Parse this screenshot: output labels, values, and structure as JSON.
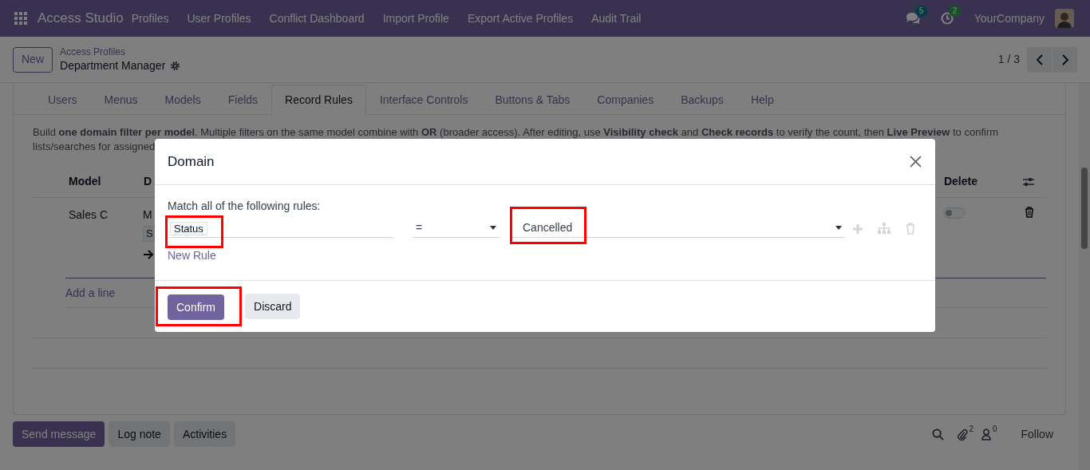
{
  "navbar": {
    "app_name": "Access Studio",
    "menu": [
      "Profiles",
      "User Profiles",
      "Conflict Dashboard",
      "Import Profile",
      "Export Active Profiles",
      "Audit Trail"
    ],
    "messages_count": "5",
    "activities_count": "2",
    "company": "YourCompany"
  },
  "control_panel": {
    "new_button": "New",
    "breadcrumb": "Access Profiles",
    "record_title": "Department Manager",
    "pager": "1 / 3"
  },
  "tabs": [
    {
      "label": "Users",
      "selected": false
    },
    {
      "label": "Menus",
      "selected": false
    },
    {
      "label": "Models",
      "selected": false
    },
    {
      "label": "Fields",
      "selected": false
    },
    {
      "label": "Record Rules",
      "selected": true
    },
    {
      "label": "Interface Controls",
      "selected": false
    },
    {
      "label": "Buttons & Tabs",
      "selected": false
    },
    {
      "label": "Companies",
      "selected": false
    },
    {
      "label": "Backups",
      "selected": false
    },
    {
      "label": "Help",
      "selected": false
    }
  ],
  "description": [
    "Build **one domain filter per model**. Multiple filters on the same model combine with **OR** (broader access). After editing, use **Visibility check** and **Check records** to verify the count, then **Live Preview** to confirm",
    "lists/searches for assigned"
  ],
  "table": {
    "columns": [
      "Model",
      "D",
      "Delete"
    ],
    "rows": [
      {
        "model": "Sales C",
        "domain": "M",
        "domain_tag": "S",
        "delete": false
      }
    ],
    "add_line": "Add a line"
  },
  "dialog": {
    "title": "Domain",
    "match_text": "Match all of the following rules:",
    "rules": [
      {
        "field": "Status",
        "field_highlighted": true,
        "operator": "=",
        "value": "Cancelled",
        "value_highlighted": true
      }
    ],
    "new_rule": "New Rule",
    "buttons": [
      {
        "label": "Confirm",
        "kind": "primary",
        "highlighted": true
      },
      {
        "label": "Discard",
        "kind": "secondary",
        "highlighted": false
      }
    ]
  },
  "chatter": {
    "buttons": [
      {
        "label": "Send message",
        "kind": "primary"
      },
      {
        "label": "Log note",
        "kind": "secondary"
      },
      {
        "label": "Activities",
        "kind": "secondary"
      }
    ],
    "attachments_count": "2",
    "followers_count": "0",
    "follow": "Follow"
  }
}
